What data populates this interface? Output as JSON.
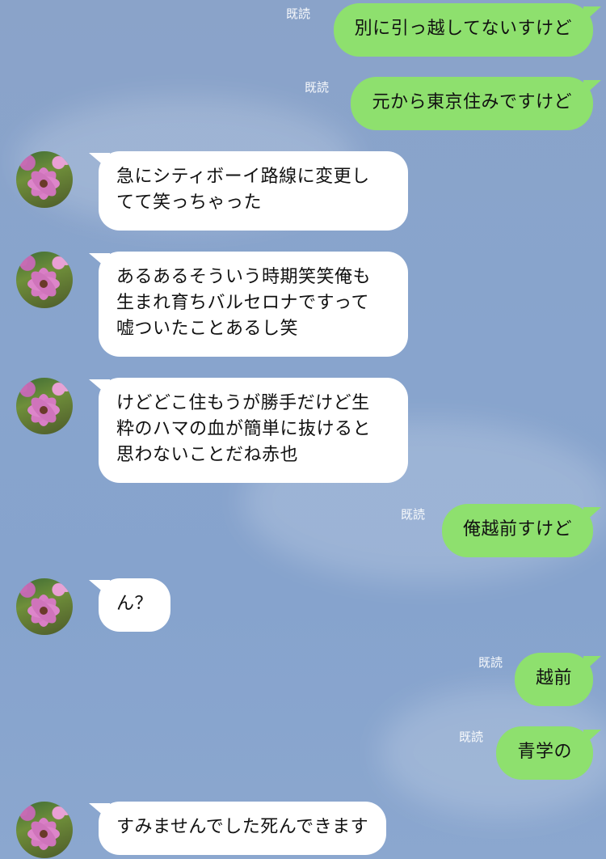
{
  "read_label": "既読",
  "messages": [
    {
      "side": "out",
      "text": "別に引っ越してないすけど"
    },
    {
      "side": "out",
      "text": "元から東京住みですけど"
    },
    {
      "side": "in",
      "text": "急にシティボーイ路線に変更し\nてて笑っちゃった"
    },
    {
      "side": "in",
      "text": "あるあるそういう時期笑笑俺も\n生まれ育ちバルセロナですって\n嘘ついたことあるし笑"
    },
    {
      "side": "in",
      "text": "けどどこ住もうが勝手だけど生\n粋のハマの血が簡単に抜けると\n思わないことだね赤也"
    },
    {
      "side": "out",
      "text": "俺越前すけど"
    },
    {
      "side": "in",
      "text": "ん？"
    },
    {
      "side": "out",
      "text": "越前"
    },
    {
      "side": "out",
      "text": "青学の"
    },
    {
      "side": "in",
      "text": "すみませんでした死んできます"
    }
  ],
  "colors": {
    "outgoing_bubble": "#8ee06e",
    "incoming_bubble": "#ffffff",
    "background": "#88a4cd"
  },
  "icons": {
    "avatar": "pink-cosmos-flower-avatar-icon"
  }
}
